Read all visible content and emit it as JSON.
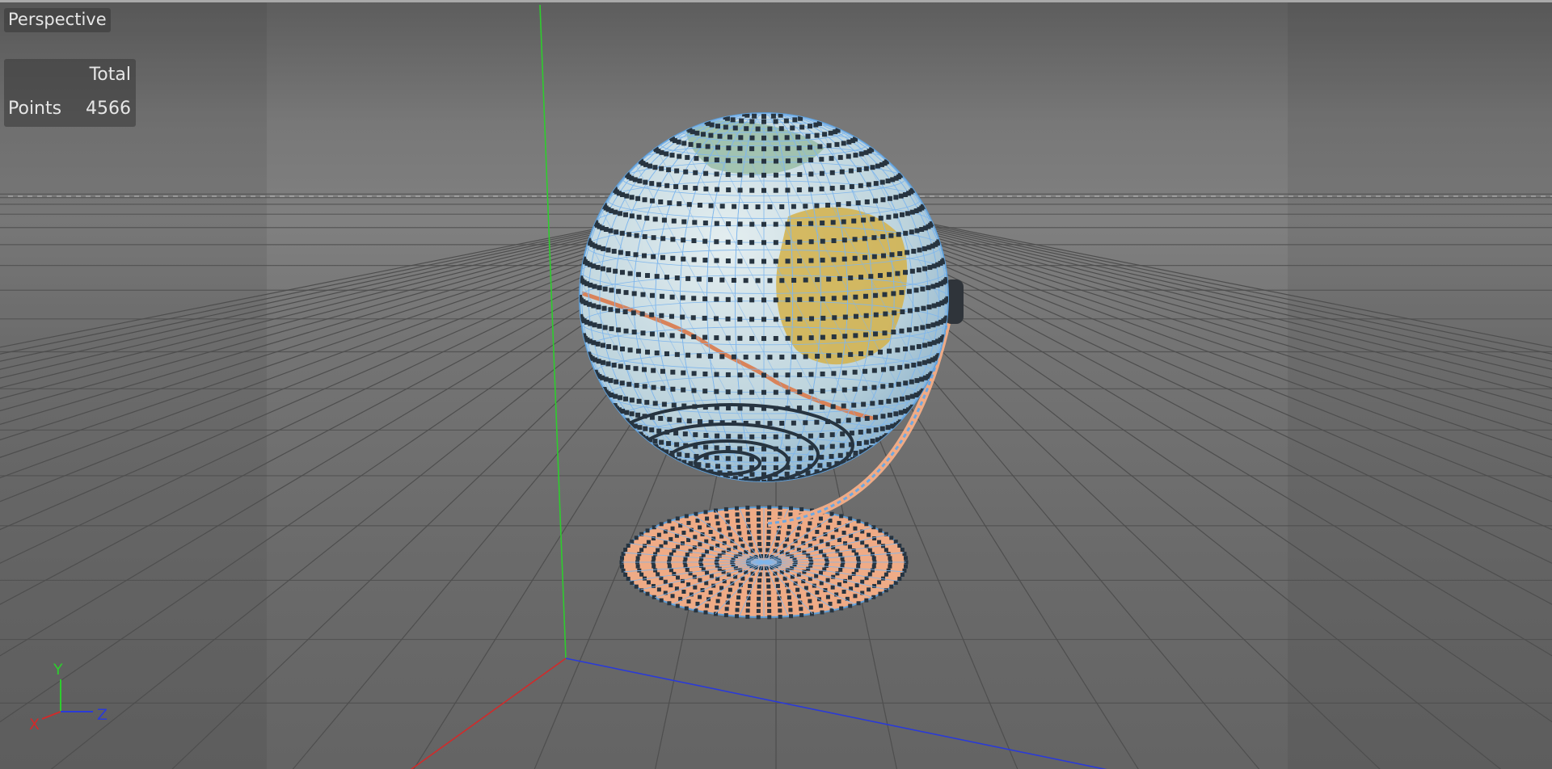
{
  "viewport": {
    "camera_label": "Perspective",
    "stats": {
      "column_header": "Total",
      "row_label": "Points",
      "row_value": "4566"
    },
    "axis_gizmo": {
      "y_label": "Y",
      "z_label": "Z",
      "x_label": "X"
    },
    "colors": {
      "x_axis": "#d22a2a",
      "y_axis": "#2ecc2e",
      "z_axis": "#2a3ad8",
      "point": "#273440",
      "edge": "#7fb6ec",
      "base_face": "#efab86",
      "ocean": "#c4dbe2",
      "land": "#d4b24a"
    },
    "object": "globe-with-stand"
  }
}
